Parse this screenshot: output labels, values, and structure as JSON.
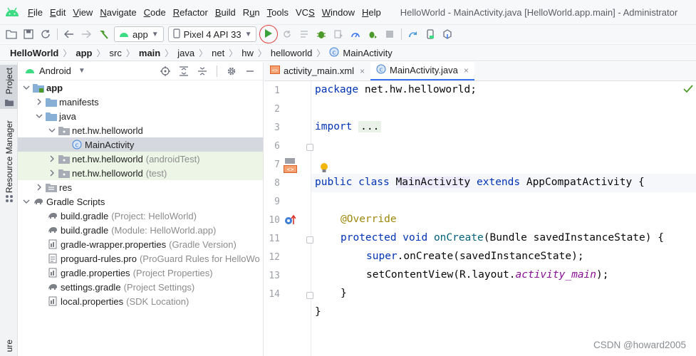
{
  "menu": {
    "items": [
      {
        "label": "File",
        "mnemonic": "F"
      },
      {
        "label": "Edit",
        "mnemonic": "E"
      },
      {
        "label": "View",
        "mnemonic": "V"
      },
      {
        "label": "Navigate",
        "mnemonic": "N"
      },
      {
        "label": "Code",
        "mnemonic": "C"
      },
      {
        "label": "Refactor",
        "mnemonic": "R"
      },
      {
        "label": "Build",
        "mnemonic": "B"
      },
      {
        "label": "Run",
        "mnemonic": "u"
      },
      {
        "label": "Tools",
        "mnemonic": "T"
      },
      {
        "label": "VCS",
        "mnemonic": "S"
      },
      {
        "label": "Window",
        "mnemonic": "W"
      },
      {
        "label": "Help",
        "mnemonic": "H"
      }
    ],
    "window_title": "HelloWorld - MainActivity.java [HelloWorld.app.main] - Administrator"
  },
  "toolbar": {
    "run_config": "app",
    "device": "Pixel 4 API 33"
  },
  "breadcrumb": {
    "items": [
      "HelloWorld",
      "app",
      "src",
      "main",
      "java",
      "net",
      "hw",
      "helloworld",
      "MainActivity"
    ]
  },
  "toolstrip": {
    "project_label": "Project",
    "resource_manager_label": "Resource Manager",
    "bottom_label": "ure"
  },
  "project_panel": {
    "view_mode": "Android",
    "tree": [
      {
        "label": "app",
        "secondary": "",
        "bold": true
      },
      {
        "label": "manifests",
        "secondary": ""
      },
      {
        "label": "java",
        "secondary": ""
      },
      {
        "label": "net.hw.helloworld",
        "secondary": ""
      },
      {
        "label": "MainActivity",
        "secondary": ""
      },
      {
        "label": "net.hw.helloworld",
        "secondary": "(androidTest)"
      },
      {
        "label": "net.hw.helloworld",
        "secondary": "(test)"
      },
      {
        "label": "res",
        "secondary": ""
      },
      {
        "label": "Gradle Scripts",
        "secondary": ""
      },
      {
        "label": "build.gradle",
        "secondary": "(Project: HelloWorld)"
      },
      {
        "label": "build.gradle",
        "secondary": "(Module: HelloWorld.app)"
      },
      {
        "label": "gradle-wrapper.properties",
        "secondary": "(Gradle Version)"
      },
      {
        "label": "proguard-rules.pro",
        "secondary": "(ProGuard Rules for HelloWo"
      },
      {
        "label": "gradle.properties",
        "secondary": "(Project Properties)"
      },
      {
        "label": "settings.gradle",
        "secondary": "(Project Settings)"
      },
      {
        "label": "local.properties",
        "secondary": "(SDK Location)"
      }
    ]
  },
  "editor": {
    "tabs": [
      {
        "label": "activity_main.xml",
        "close": "×"
      },
      {
        "label": "MainActivity.java",
        "close": "×"
      }
    ],
    "line_numbers": [
      "1",
      "2",
      "3",
      "6",
      "7",
      "8",
      "9",
      "10",
      "11",
      "12",
      "13",
      "14"
    ],
    "code": {
      "l1_kw": "package",
      "l1_rest": " net.hw.helloworld;",
      "l3_kw": "import",
      "l3_fold": "...",
      "l7_kw": "public class",
      "l7_class": "MainActivity",
      "l7_ext": "extends",
      "l7_rest": " AppCompatActivity {",
      "l9_ann": "@Override",
      "l10_kw": "protected void",
      "l10_fn": "onCreate",
      "l10_rest": "(Bundle savedInstanceState) {",
      "l11_kw": "super",
      "l11_rest": ".onCreate(savedInstanceState);",
      "l12_a": "setContentView(R.layout.",
      "l12_field": "activity_main",
      "l12_b": ");",
      "l13": "}",
      "l14": "}"
    }
  },
  "watermark": "CSDN @howard2005"
}
